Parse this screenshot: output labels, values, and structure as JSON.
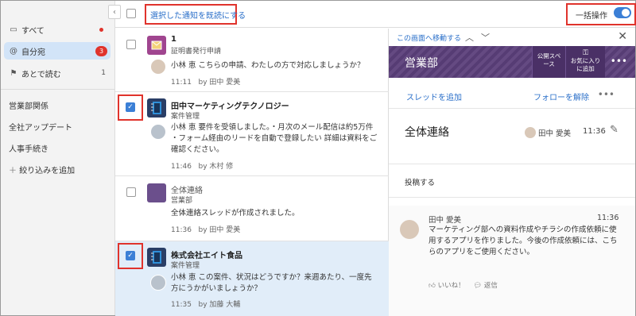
{
  "sidebar": {
    "items": [
      {
        "label": "すべて",
        "icon": "inbox-icon"
      },
      {
        "label": "自分宛",
        "icon": "at-icon",
        "badge": "3"
      },
      {
        "label": "あとで読む",
        "icon": "flag-icon",
        "count": "1"
      }
    ],
    "filters": [
      "営業部関係",
      "全社アップデート",
      "人事手続き"
    ],
    "add_filter": "絞り込みを追加"
  },
  "topbar": {
    "mark_read": "選択した通知を既読にする",
    "bulk_label": "一括操作"
  },
  "notifications": [
    {
      "title": "1",
      "app": "証明書発行申請",
      "message": "小林 恵 こちらの申請、わたしの方で対応しましょうか？",
      "time": "11:11",
      "by": "by 田中 愛美",
      "checked": false
    },
    {
      "title": "田中マーケティングテクノロジー",
      "app": "案件管理",
      "message": "小林 恵 要件を受領しました。・月次のメール配信は約5万件 ・フォーム経由のリードを自動で登録したい 詳細は資料をご確認ください。",
      "time": "11:46",
      "by": "by 木村 修",
      "checked": true
    },
    {
      "title": "全体連絡",
      "app": "営業部",
      "message": "全体連絡スレッドが作成されました。",
      "time": "11:36",
      "by": "by 田中 愛美",
      "checked": false
    },
    {
      "title": "株式会社エイト食品",
      "app": "案件管理",
      "message": "小林 恵 この案件、状況はどうですか？来週あたり、一度先方にうかがいましょうか？",
      "time": "11:35",
      "by": "by 加藤 大輔",
      "checked": true
    }
  ],
  "panel": {
    "goto": "この画面へ移動する",
    "space_name": "営業部",
    "space_btn": "公開スペース",
    "fav_btn": "お気に入りに追加",
    "thread_add": "スレッドを追加",
    "unfollow": "フォローを解除",
    "post_title": "全体連絡",
    "post_author": "田中 愛美",
    "post_time": "11:36",
    "post_button": "投稿する",
    "comment": {
      "name": "田中 愛美",
      "time": "11:36",
      "body": "マーケティング部への資料作成やチラシの作成依頼に使用するアプリを作りました。今後の作成依頼には、こちらのアプリをご使用ください。",
      "like": "いいね！",
      "reply": "返信"
    }
  },
  "colors": {
    "accent": "#3b7fd6",
    "highlight": "#e0332c",
    "banner": "#5b3f7a",
    "selected_row": "#e1edf9"
  }
}
